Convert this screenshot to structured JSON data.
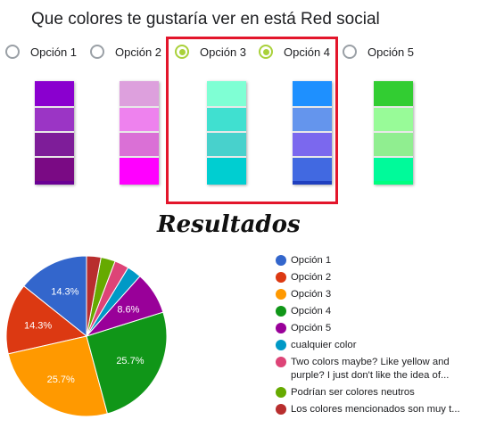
{
  "question": {
    "title": "Que colores te gustaría ver en está Red social"
  },
  "options": [
    {
      "label": "Opción 1",
      "checked": false
    },
    {
      "label": "Opción 2",
      "checked": false
    },
    {
      "label": "Opción 3",
      "checked": true
    },
    {
      "label": "Opción 4",
      "checked": true
    },
    {
      "label": "Opción 5",
      "checked": false
    }
  ],
  "swatches": [
    {
      "colors": [
        "#8a00cf",
        "#9b35c5",
        "#7e1d99",
        "#7a0a84",
        "#6a0094"
      ]
    },
    {
      "colors": [
        "#dda0dd",
        "#ee82ee",
        "#da70d6",
        "#ff00ff",
        "#ff00ff"
      ]
    },
    {
      "colors": [
        "#7fffd4",
        "#40e0d0",
        "#48d1cc",
        "#00ced1",
        "#00ced1"
      ]
    },
    {
      "colors": [
        "#1e90ff",
        "#6495ed",
        "#7b68ee",
        "#4169e1",
        "#1f3fbf"
      ]
    },
    {
      "colors": [
        "#32cd32",
        "#98fb98",
        "#90ee90",
        "#00fa9a",
        "#00ff7f"
      ]
    }
  ],
  "results": {
    "title": "Resultados"
  },
  "chart_data": {
    "type": "pie",
    "title": "",
    "slices": [
      {
        "label": "Opción 1",
        "value": 14.3,
        "color": "#3366cc",
        "text": "14.3%"
      },
      {
        "label": "Opción 2",
        "value": 14.3,
        "color": "#dc3912",
        "text": "14.3%"
      },
      {
        "label": "Opción 3",
        "value": 25.7,
        "color": "#ff9900",
        "text": "25.7%"
      },
      {
        "label": "Opción 4",
        "value": 25.7,
        "color": "#109618",
        "text": "25.7%"
      },
      {
        "label": "Opción 5",
        "value": 8.6,
        "color": "#990099",
        "text": "8.6%"
      },
      {
        "label": "cualquier color",
        "value": 2.9,
        "color": "#0099c6",
        "text": ""
      },
      {
        "label": "Two colors maybe? Like yellow and purple? I just don't like the idea of...",
        "value": 2.9,
        "color": "#dd4477",
        "text": ""
      },
      {
        "label": "Podrían ser colores neutros",
        "value": 2.9,
        "color": "#66aa00",
        "text": ""
      },
      {
        "label": "Los colores mencionados son muy t...",
        "value": 2.9,
        "color": "#b82e2e",
        "text": ""
      }
    ],
    "legend": [
      "Opción 1",
      "Opción 2",
      "Opción 3",
      "Opción 4",
      "Opción 5",
      "cualquier color",
      "Two colors maybe? Like yellow and purple? I just don't like the idea of...",
      "Podrían ser colores neutros",
      "Los colores mencionados son muy t..."
    ],
    "legend_position": "right"
  }
}
